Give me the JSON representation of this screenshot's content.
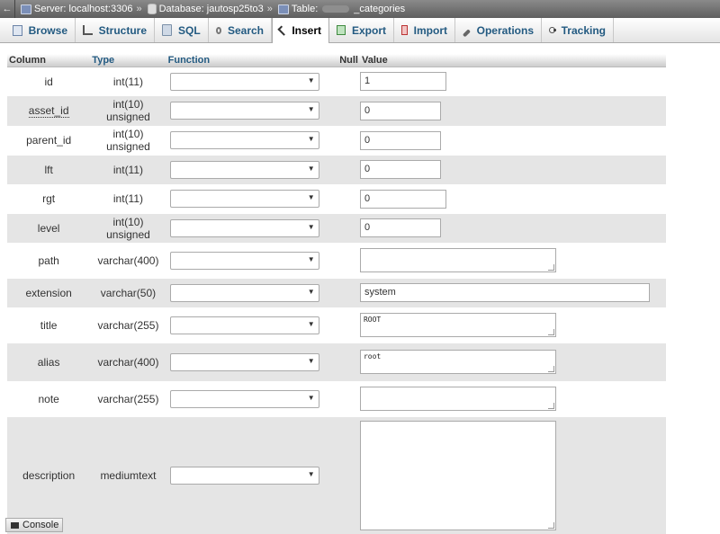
{
  "breadcrumb": {
    "back": "←",
    "server": "Server: localhost:3306",
    "database": "Database: jautosp25to3",
    "table_prefix": "Table:",
    "table_suffix": "_categories",
    "separator": "»"
  },
  "tabs": [
    {
      "label": "Browse",
      "icon": "browse-icon"
    },
    {
      "label": "Structure",
      "icon": "structure-icon"
    },
    {
      "label": "SQL",
      "icon": "sql-icon"
    },
    {
      "label": "Search",
      "icon": "search-icon"
    },
    {
      "label": "Insert",
      "icon": "insert-icon",
      "active": true
    },
    {
      "label": "Export",
      "icon": "export-icon"
    },
    {
      "label": "Import",
      "icon": "import-icon"
    },
    {
      "label": "Operations",
      "icon": "wrench-icon"
    },
    {
      "label": "Tracking",
      "icon": "eye-icon"
    }
  ],
  "headers": {
    "column": "Column",
    "type": "Type",
    "function": "Function",
    "null": "Null",
    "value": "Value"
  },
  "rows": [
    {
      "column": "id",
      "type": "int(11)",
      "value": "1"
    },
    {
      "column": "asset_id",
      "type": "int(10) unsigned",
      "value": "0"
    },
    {
      "column": "parent_id",
      "type": "int(10) unsigned",
      "value": "0"
    },
    {
      "column": "lft",
      "type": "int(11)",
      "value": "0"
    },
    {
      "column": "rgt",
      "type": "int(11)",
      "value": "0"
    },
    {
      "column": "level",
      "type": "int(10) unsigned",
      "value": "0"
    },
    {
      "column": "path",
      "type": "varchar(400)",
      "value": ""
    },
    {
      "column": "extension",
      "type": "varchar(50)",
      "value": "system"
    },
    {
      "column": "title",
      "type": "varchar(255)",
      "value": "ROOT"
    },
    {
      "column": "alias",
      "type": "varchar(400)",
      "value": "root"
    },
    {
      "column": "note",
      "type": "varchar(255)",
      "value": ""
    },
    {
      "column": "description",
      "type": "mediumtext",
      "value": ""
    }
  ],
  "console": {
    "label": "Console"
  }
}
